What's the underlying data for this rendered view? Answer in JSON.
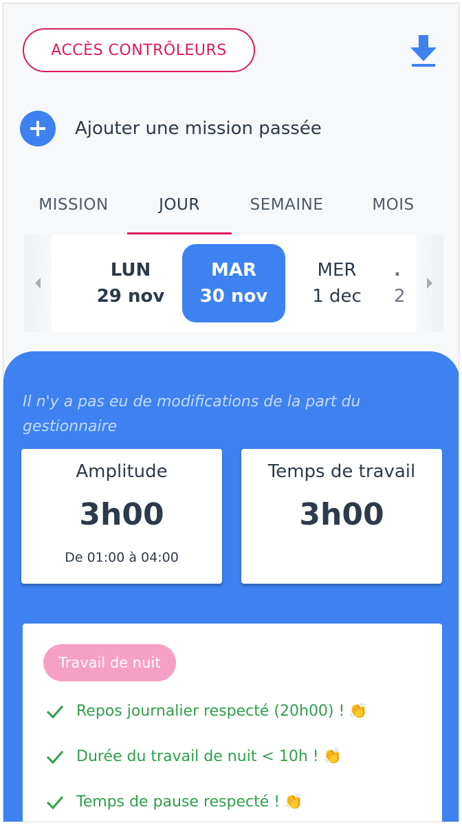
{
  "header": {
    "controllers_button": "ACCÈS CONTRÔLEURS",
    "download_icon": "download-icon"
  },
  "add_mission": {
    "icon": "plus-circle-icon",
    "label": "Ajouter une mission passée"
  },
  "tabs": [
    {
      "label": "MISSION",
      "active": false
    },
    {
      "label": "JOUR",
      "active": true
    },
    {
      "label": "SEMAINE",
      "active": false
    },
    {
      "label": "MOIS",
      "active": false
    }
  ],
  "days": [
    {
      "name": "LUN",
      "date": "29 nov",
      "state": "bold"
    },
    {
      "name": "MAR",
      "date": "30 nov",
      "state": "selected"
    },
    {
      "name": "MER",
      "date": "1 dec",
      "state": "plain"
    },
    {
      "name": ".",
      "date": "2",
      "state": "partial"
    }
  ],
  "panel": {
    "notice": "Il n'y a pas eu de modifications de la part du gestionnaire",
    "amplitude": {
      "title": "Amplitude",
      "value": "3h00",
      "range": "De 01:00 à 04:00"
    },
    "work_time": {
      "title": "Temps de travail",
      "value": "3h00"
    },
    "badge": "Travail de nuit",
    "alerts": [
      {
        "text": "Repos journalier respecté (20h00) !",
        "emoji": "👏"
      },
      {
        "text": "Durée du travail de nuit < 10h !",
        "emoji": "👏"
      },
      {
        "text": "Temps de pause respecté !",
        "emoji": "👏"
      }
    ]
  },
  "colors": {
    "accent_pink": "#e0195b",
    "primary_blue": "#3d82f0",
    "success_green": "#2fa04a",
    "badge_pink": "#f7a0c5"
  }
}
